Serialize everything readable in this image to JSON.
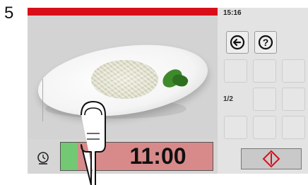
{
  "step_number": "5",
  "status": {
    "time": "15:16",
    "page_indicator": "1/2"
  },
  "timer": {
    "display": "11:00",
    "progress_fraction": 0.11
  },
  "icons": {
    "back": "arrow-left-icon",
    "help": "question-mark-icon",
    "timer": "alarm-clock-icon",
    "start": "start-stop-diamond-icon",
    "finger": "finger-pointer-icon"
  },
  "colors": {
    "top_bar": "#d80f1a",
    "progress_remaining": "#d88a8a",
    "progress_elapsed": "#73c873",
    "start_icon": "#d80f1a"
  }
}
